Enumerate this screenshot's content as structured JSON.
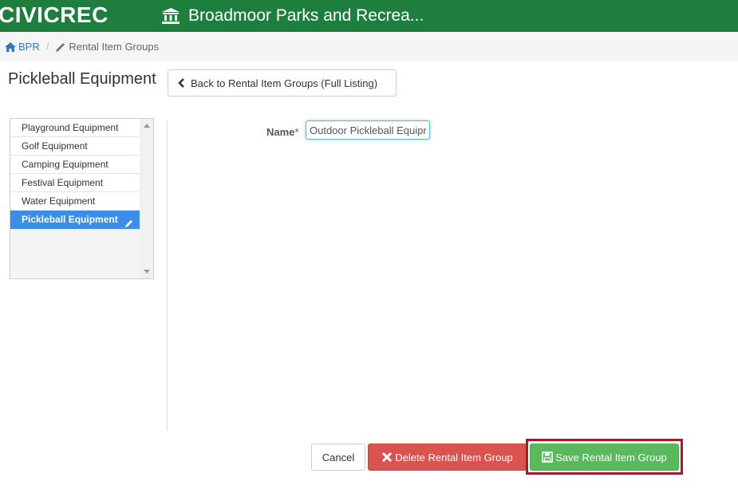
{
  "header": {
    "brand": "CIVICREC",
    "org_name": "Broadmoor Parks and Recrea...",
    "bg_color": "#1e7e3e"
  },
  "breadcrumb": {
    "home_label": "BPR",
    "separator": "/",
    "current_label": "Rental Item Groups"
  },
  "page": {
    "title": "Pickleball Equipment",
    "back_button_label": "Back to Rental Item Groups (Full Listing)"
  },
  "groups_list": {
    "items": [
      {
        "label": "Playground Equipment"
      },
      {
        "label": "Golf Equipment"
      },
      {
        "label": "Camping Equipment"
      },
      {
        "label": "Festival Equipment"
      },
      {
        "label": "Water Equipment"
      },
      {
        "label": "Pickleball Equipment",
        "selected": true
      }
    ],
    "selected_color": "#3a8ee6"
  },
  "form": {
    "name_label": "Name",
    "required_marker": "*",
    "name_value": "Outdoor Pickleball Equipment"
  },
  "actions": {
    "cancel_label": "Cancel",
    "delete_label": "Delete Rental Item Group",
    "save_label": "Save Rental Item Group",
    "delete_color": "#d9534f",
    "save_color": "#5cb85c",
    "highlight_color": "#a31b2e"
  },
  "icons": {
    "org": "bank-icon",
    "home": "home-icon",
    "breadcrumb_current": "pencil-icon",
    "back": "chevron-left-icon",
    "list_edit": "pencil-icon",
    "delete": "close-icon",
    "save": "floppy-disk-icon"
  }
}
